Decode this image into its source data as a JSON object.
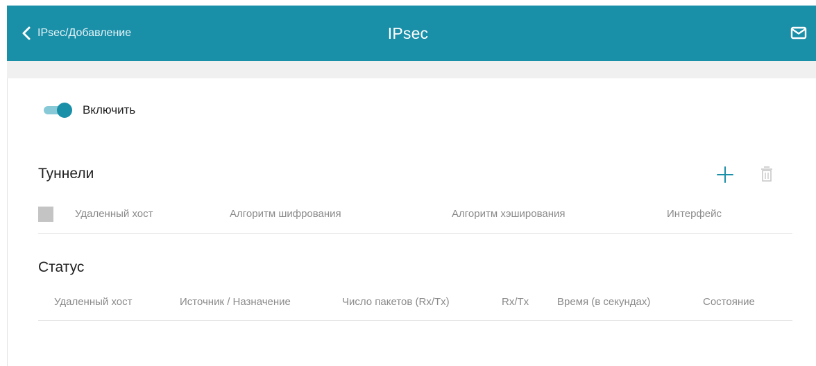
{
  "header": {
    "back_label": "IPsec/Добавление",
    "title": "IPsec",
    "icons": {
      "back": "chevron-left-icon",
      "mail": "mail-icon"
    },
    "background": "#1a8fa8"
  },
  "toggle": {
    "label": "Включить",
    "enabled": true,
    "color": "#1a8fa8"
  },
  "tunnels": {
    "title": "Туннели",
    "columns": [
      "Удаленный хост",
      "Алгоритм шифрования",
      "Алгоритм хэширования",
      "Интерфейс"
    ],
    "icons": {
      "add": "plus-icon",
      "delete": "trash-icon"
    }
  },
  "status": {
    "title": "Статус",
    "columns": [
      "Удаленный хост",
      "Источник / Назначение",
      "Число пакетов (Rx/Tx)",
      "Rx/Tx",
      "Время (в секундах)",
      "Состояние"
    ]
  }
}
